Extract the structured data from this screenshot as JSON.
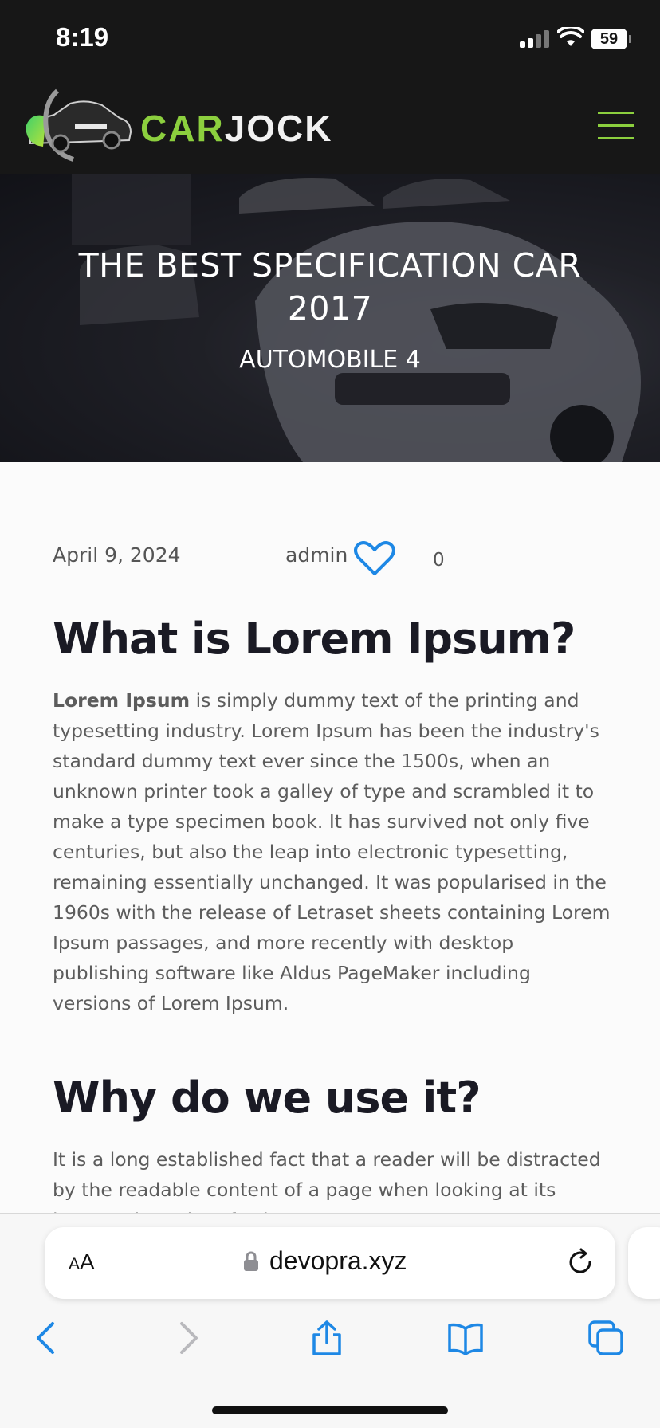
{
  "status": {
    "time": "8:19",
    "battery": "59"
  },
  "header": {
    "logo_car": "CAR",
    "logo_jock": "JOCK"
  },
  "hero": {
    "title": "THE BEST SPECIFICATION CAR 2017",
    "subtitle": "AUTOMOBILE 4"
  },
  "post": {
    "date": "April 9, 2024",
    "author": "admin",
    "likes": "0",
    "heading1": "What is Lorem Ipsum?",
    "para1_bold": "Lorem Ipsum",
    "para1_rest": " is simply dummy text of the printing and typesetting industry. Lorem Ipsum has been the industry's standard dummy text ever since the 1500s, when an unknown printer took a galley of type and scrambled it to make a type specimen book. It has survived not only five centuries, but also the leap into electronic typesetting, remaining essentially unchanged. It was popularised in the 1960s with the release of Letraset sheets containing Lorem Ipsum passages, and more recently with desktop publishing software like Aldus PageMaker including versions of Lorem Ipsum.",
    "heading2": "Why do we use it?",
    "para2": "It is a long established fact that a reader will be distracted by the readable content of a page when looking at its layout. The point of using Lorem Ipsum"
  },
  "browser": {
    "aa_small": "A",
    "aa_large": "A",
    "url": "devopra.xyz"
  },
  "colors": {
    "brand_green": "#8ccf3e",
    "header_bg": "#171717",
    "link_blue": "#1e88e5"
  }
}
